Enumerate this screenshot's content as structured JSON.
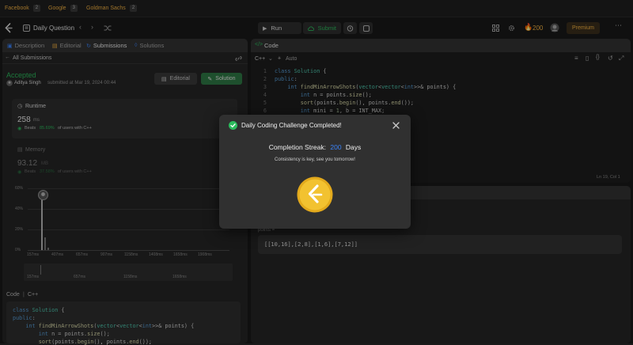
{
  "tags": [
    {
      "name": "Facebook",
      "count": "2"
    },
    {
      "name": "Google",
      "count": "3"
    },
    {
      "name": "Goldman Sachs",
      "count": "2"
    }
  ],
  "nav": {
    "daily_question": "Daily Question",
    "run_label": "Run",
    "submit_label": "Submit",
    "coins": "200",
    "premium_label": "Premium"
  },
  "left_tabs": [
    "Description",
    "Editorial",
    "Submissions",
    "Solutions"
  ],
  "submission": {
    "back_label": "All Submissions",
    "status": "Accepted",
    "user": "Aditya Singh",
    "submitted_at": "submitted at Mar 19, 2024 00:44",
    "editorial_btn": "Editorial",
    "solution_btn": "Solution"
  },
  "runtime": {
    "label": "Runtime",
    "value": "258",
    "unit": "ms",
    "beats_prefix": "Beats",
    "beats_pct": "85.69%",
    "beats_suffix": "of users with C++"
  },
  "memory": {
    "label": "Memory",
    "value": "93.12",
    "unit": "MB",
    "beats_prefix": "Beats",
    "beats_pct": "37.58%",
    "beats_suffix": "of users with C++"
  },
  "chart_data": {
    "type": "bar",
    "y_ticks": [
      "60%",
      "40%",
      "20%",
      "0%"
    ],
    "x_ticks": [
      "157ms",
      "407ms",
      "657ms",
      "907ms",
      "1158ms",
      "1408ms",
      "1658ms",
      "1908ms"
    ],
    "ylim": [
      0,
      60
    ],
    "values": [
      52,
      12,
      2
    ],
    "mini_ticks": [
      "157ms",
      "657ms",
      "1158ms",
      "1658ms"
    ]
  },
  "code_section": {
    "label": "Code",
    "lang": "C++",
    "lines": [
      "class Solution {",
      "public:",
      "    int findMinArrowShots(vector<vector<int>>& points) {",
      "        int n = points.size();",
      "        sort(points.begin(), points.end());"
    ]
  },
  "editor": {
    "title": "Code",
    "lang": "C++",
    "mode": "Auto",
    "status": "Ln 19, Col 1",
    "lines": [
      "class Solution {",
      "public:",
      "    int findMinArrowShots(vector<vector<int>>& points) {",
      "        int n = points.size();",
      "        sort(points.begin(), points.end());",
      "        int mini = 1, b = INT_MAX;"
    ]
  },
  "testcase": {
    "input_label": "points =",
    "input_value": "[[10,16],[2,8],[1,6],[7,12]]"
  },
  "modal": {
    "title": "Daily Coding Challenge Completed!",
    "streak_label": "Completion Streak:",
    "streak_value": "200",
    "streak_unit": "Days",
    "subtitle": "Consistency is key, see you tomorrow!"
  },
  "colors": {
    "accent_orange": "#f5b342",
    "accepted_green": "#2cbb5d",
    "streak_blue": "#3b82f6",
    "coin_gold": "#f2c230"
  }
}
